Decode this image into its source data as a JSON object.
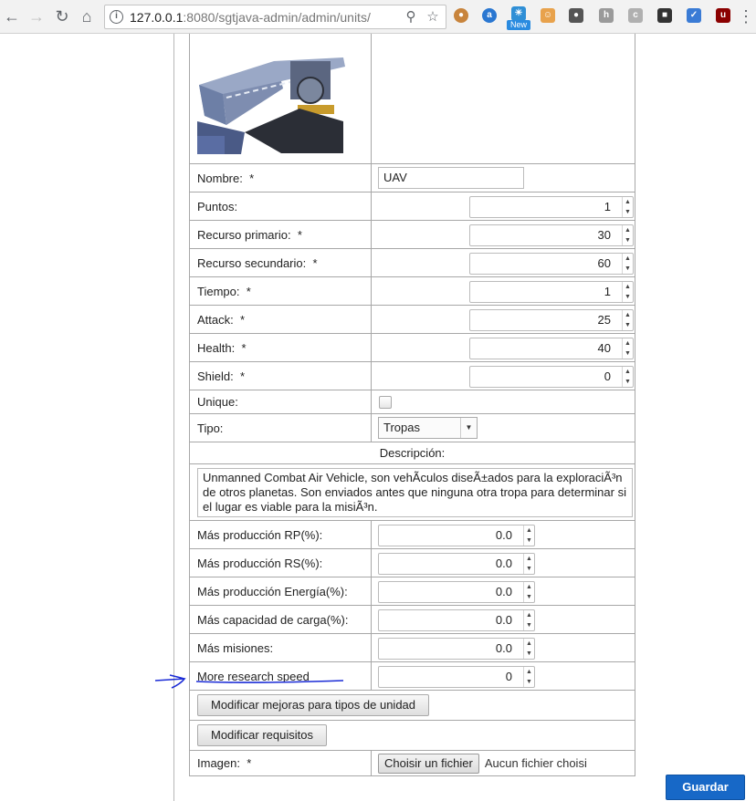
{
  "browser": {
    "url_host": "127.0.0.1",
    "url_rest": ":8080/sgtjava-admin/admin/units/",
    "ext_new_badge": "New"
  },
  "form": {
    "fields": [
      {
        "label": "Nombre:",
        "required": "*",
        "value": "UAV"
      },
      {
        "label": "Puntos:",
        "required": "",
        "value": "1"
      },
      {
        "label": "Recurso primario:",
        "required": "*",
        "value": "30"
      },
      {
        "label": "Recurso secundario:",
        "required": "*",
        "value": "60"
      },
      {
        "label": "Tiempo:",
        "required": "*",
        "value": "1"
      },
      {
        "label": "Attack:",
        "required": "*",
        "value": "25"
      },
      {
        "label": "Health:",
        "required": "*",
        "value": "40"
      },
      {
        "label": "Shield:",
        "required": "*",
        "value": "0"
      },
      {
        "label": "Unique:",
        "required": "",
        "value": ""
      },
      {
        "label": "Tipo:",
        "required": "",
        "value": "Tropas"
      }
    ],
    "description_label": "Descripción:",
    "description_text": "Unmanned Combat Air Vehicle, son vehÃculos diseÃ±ados para la exploraciÃ³n de otros planetas. Son enviados antes que ninguna otra tropa para determinar si el lugar es viable para la misiÃ³n.",
    "improvements": [
      {
        "label": "Más producción RP(%):",
        "value": "0.0"
      },
      {
        "label": "Más producción RS(%):",
        "value": "0.0"
      },
      {
        "label": "Más producción Energía(%):",
        "value": "0.0"
      },
      {
        "label": "Más capacidad de carga(%):",
        "value": "0.0"
      },
      {
        "label": "Más misiones:",
        "value": "0.0"
      },
      {
        "label": "More research speed",
        "value": "0"
      }
    ],
    "modify_unit_type_improvements_label": "Modificar mejoras para tipos de unidad",
    "modify_requirements_label": "Modificar requisitos",
    "image_label": "Imagen:",
    "image_required": "*",
    "choose_file_label": "Choisir un fichier",
    "no_file_label": "Aucun fichier choisi",
    "save_label": "Guardar"
  },
  "colors": {
    "save_button": "#1768c7",
    "annotation": "#1a2bd6"
  }
}
